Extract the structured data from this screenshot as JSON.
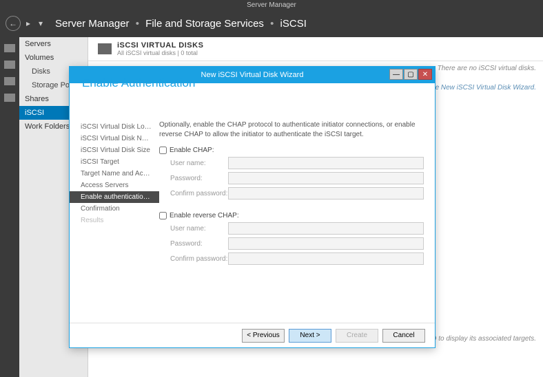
{
  "window_title": "Server Manager",
  "breadcrumb": {
    "a": "Server Manager",
    "b": "File and Storage Services",
    "c": "iSCSI"
  },
  "sidebar": {
    "items": [
      "Servers",
      "Volumes",
      "Disks",
      "Storage Po",
      "Shares",
      "iSCSI",
      "Work Folders"
    ]
  },
  "content": {
    "heading": "iSCSI VIRTUAL DISKS",
    "sub": "All iSCSI virtual disks | 0 total",
    "hint_right": "There are no iSCSI virtual disks.",
    "hint_link": "disk, start the New iSCSI Virtual Disk Wizard.",
    "hint_bottom": "VHD to display its associated targets."
  },
  "dialog": {
    "title": "New iSCSI Virtual Disk Wizard",
    "heading": "Enable Authentication",
    "steps": [
      "iSCSI Virtual Disk Location",
      "iSCSI Virtual Disk Name",
      "iSCSI Virtual Disk Size",
      "iSCSI Target",
      "Target Name and Access",
      "Access Servers",
      "Enable authentication ser...",
      "Confirmation",
      "Results"
    ],
    "desc": "Optionally, enable the CHAP protocol to authenticate initiator connections, or enable reverse CHAP to allow the initiator to authenticate the iSCSI target.",
    "chap_label": "Enable CHAP:",
    "rchap_label": "Enable reverse CHAP:",
    "fields": {
      "user": "User name:",
      "pass": "Password:",
      "confirm": "Confirm password:"
    },
    "buttons": {
      "prev": "< Previous",
      "next": "Next >",
      "create": "Create",
      "cancel": "Cancel"
    }
  }
}
